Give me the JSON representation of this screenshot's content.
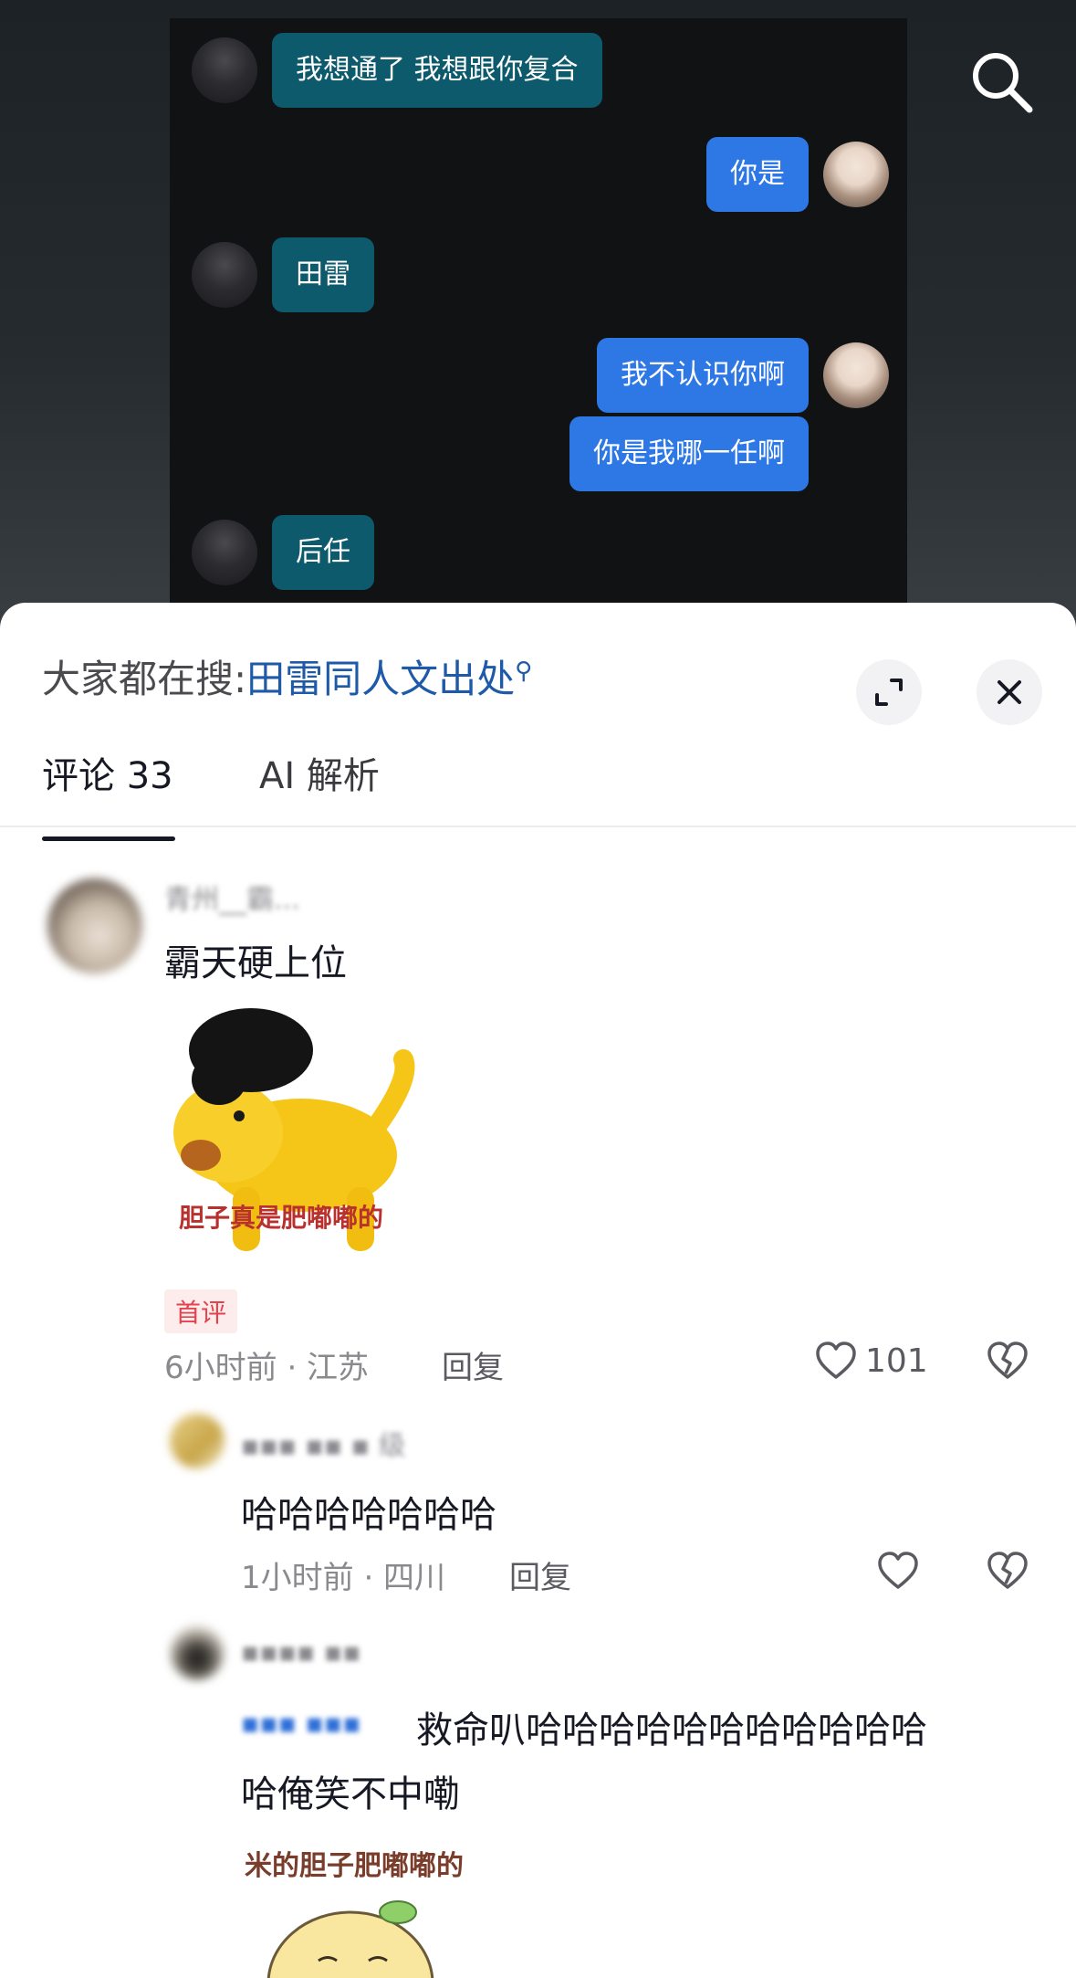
{
  "chat": {
    "messages": [
      {
        "side": "left",
        "text": "我想通了 我想跟你复合"
      },
      {
        "side": "right",
        "text": "你是"
      },
      {
        "side": "left",
        "text": "田雷"
      },
      {
        "side": "right",
        "text": "我不认识你啊"
      },
      {
        "side": "right",
        "text": "你是我哪一任啊"
      },
      {
        "side": "left",
        "text": "后任"
      }
    ]
  },
  "header": {
    "hot_search_prefix": "大家都在搜:",
    "hot_search_keyword": "田雷同人文出处",
    "icons": {
      "search": "search-icon",
      "expand": "expand-icon",
      "close": "close-icon"
    }
  },
  "tabs": [
    {
      "label": "评论 33",
      "active": true
    },
    {
      "label": "AI 解析",
      "active": false
    }
  ],
  "comments": [
    {
      "username": "青州__霸...",
      "text": "霸天硬上位",
      "sticker_caption": "胆子真是肥嘟嘟的",
      "badge": "首评",
      "time_location": "6小时前 · 江苏",
      "reply_label": "回复",
      "like_count": "101"
    }
  ],
  "replies": [
    {
      "username": "▪▪▪ ▪▪ ▪ 级",
      "text": "哈哈哈哈哈哈哈",
      "time_location": "1小时前 · 四川",
      "reply_label": "回复"
    },
    {
      "username": "▪▪▪▪ ▪▪",
      "text_line1": "救命叭哈哈哈哈哈哈哈哈哈哈哈",
      "text_line2": "哈俺笑不中嘞",
      "mention": "▪▪▪ ▪▪▪",
      "sticker_caption": "米的胆子肥嘟嘟的"
    }
  ],
  "colors": {
    "teal_bubble": "#0c5a6c",
    "blue_bubble": "#2e78e6",
    "keyword": "#1e5aa8",
    "badge_red": "#e5424d"
  }
}
